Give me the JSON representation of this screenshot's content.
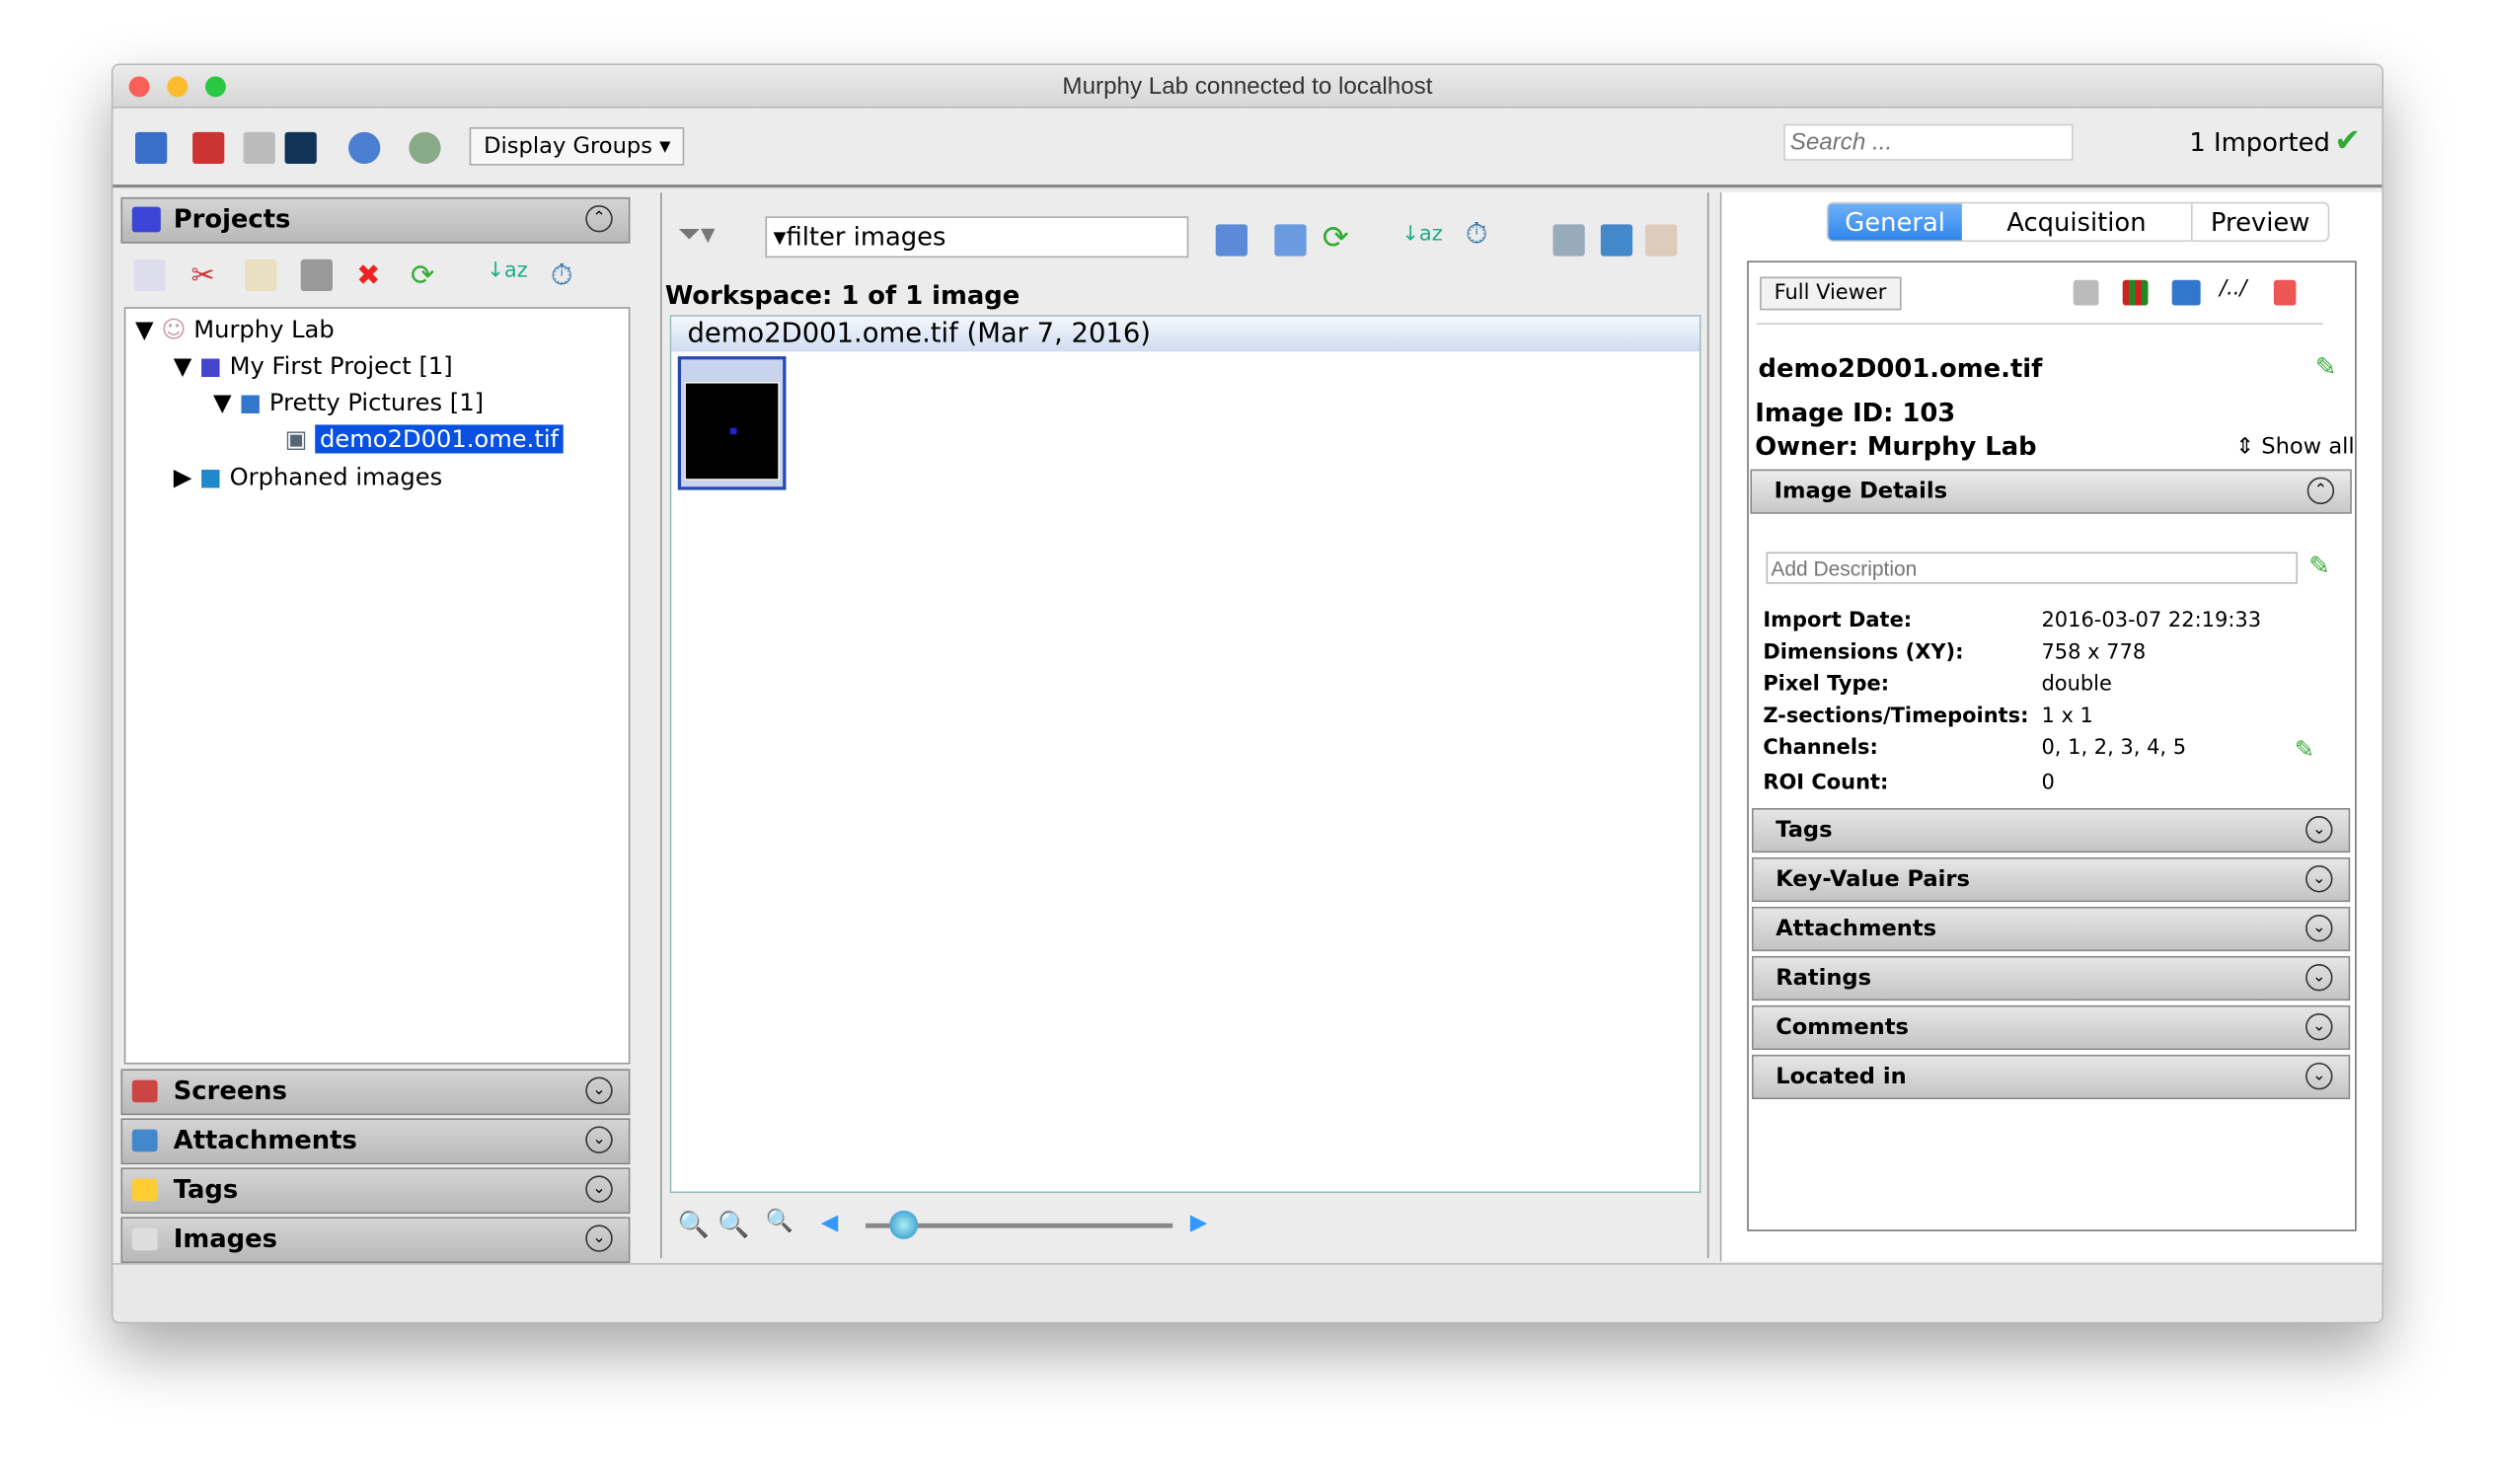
{
  "window": {
    "title": "Murphy Lab connected to localhost"
  },
  "toolbar": {
    "display_groups": "Display Groups",
    "search_placeholder": "Search ...",
    "imported": "1 Imported"
  },
  "left": {
    "projects_title": "Projects",
    "tree": [
      {
        "label": "Murphy Lab"
      },
      {
        "label": "My First Project [1]"
      },
      {
        "label": "Pretty Pictures [1]"
      },
      {
        "label": "demo2D001.ome.tif"
      },
      {
        "label": "Orphaned images"
      }
    ],
    "sections": [
      "Screens",
      "Attachments",
      "Tags",
      "Images"
    ]
  },
  "center": {
    "filter_text": "filter  images",
    "workspace": "Workspace: 1 of 1 image",
    "group_header": "demo2D001.ome.tif (Mar 7, 2016)",
    "zoom_value": 0.1
  },
  "right": {
    "tabs": [
      "General",
      "Acquisition",
      "Preview"
    ],
    "full_viewer": "Full Viewer",
    "name": "demo2D001.ome.tif",
    "image_id": "Image ID: 103",
    "owner": "Owner: Murphy Lab",
    "show_all": "Show all",
    "image_details_title": "Image Details",
    "description_placeholder": "Add Description",
    "details": [
      {
        "k": "Import Date:",
        "v": "2016-03-07 22:19:33"
      },
      {
        "k": "Dimensions (XY):",
        "v": "758 x 778"
      },
      {
        "k": "Pixel Type:",
        "v": "double"
      },
      {
        "k": "Z-sections/Timepoints:",
        "v": "1 x 1"
      },
      {
        "k": "Channels:",
        "v": "0, 1, 2, 3, 4, 5"
      },
      {
        "k": "ROI Count:",
        "v": "0"
      }
    ],
    "sections": [
      "Tags",
      "Key-Value Pairs",
      "Attachments",
      "Ratings",
      "Comments",
      "Located in"
    ]
  }
}
